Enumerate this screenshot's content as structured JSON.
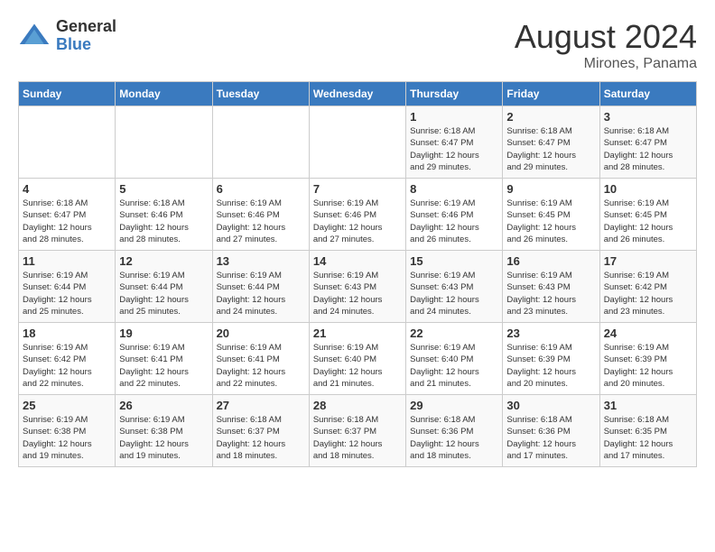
{
  "header": {
    "logo_general": "General",
    "logo_blue": "Blue",
    "month_year": "August 2024",
    "location": "Mirones, Panama"
  },
  "days_of_week": [
    "Sunday",
    "Monday",
    "Tuesday",
    "Wednesday",
    "Thursday",
    "Friday",
    "Saturday"
  ],
  "weeks": [
    [
      {
        "day": "",
        "info": ""
      },
      {
        "day": "",
        "info": ""
      },
      {
        "day": "",
        "info": ""
      },
      {
        "day": "",
        "info": ""
      },
      {
        "day": "1",
        "info": "Sunrise: 6:18 AM\nSunset: 6:47 PM\nDaylight: 12 hours\nand 29 minutes."
      },
      {
        "day": "2",
        "info": "Sunrise: 6:18 AM\nSunset: 6:47 PM\nDaylight: 12 hours\nand 29 minutes."
      },
      {
        "day": "3",
        "info": "Sunrise: 6:18 AM\nSunset: 6:47 PM\nDaylight: 12 hours\nand 28 minutes."
      }
    ],
    [
      {
        "day": "4",
        "info": "Sunrise: 6:18 AM\nSunset: 6:47 PM\nDaylight: 12 hours\nand 28 minutes."
      },
      {
        "day": "5",
        "info": "Sunrise: 6:18 AM\nSunset: 6:46 PM\nDaylight: 12 hours\nand 28 minutes."
      },
      {
        "day": "6",
        "info": "Sunrise: 6:19 AM\nSunset: 6:46 PM\nDaylight: 12 hours\nand 27 minutes."
      },
      {
        "day": "7",
        "info": "Sunrise: 6:19 AM\nSunset: 6:46 PM\nDaylight: 12 hours\nand 27 minutes."
      },
      {
        "day": "8",
        "info": "Sunrise: 6:19 AM\nSunset: 6:46 PM\nDaylight: 12 hours\nand 26 minutes."
      },
      {
        "day": "9",
        "info": "Sunrise: 6:19 AM\nSunset: 6:45 PM\nDaylight: 12 hours\nand 26 minutes."
      },
      {
        "day": "10",
        "info": "Sunrise: 6:19 AM\nSunset: 6:45 PM\nDaylight: 12 hours\nand 26 minutes."
      }
    ],
    [
      {
        "day": "11",
        "info": "Sunrise: 6:19 AM\nSunset: 6:44 PM\nDaylight: 12 hours\nand 25 minutes."
      },
      {
        "day": "12",
        "info": "Sunrise: 6:19 AM\nSunset: 6:44 PM\nDaylight: 12 hours\nand 25 minutes."
      },
      {
        "day": "13",
        "info": "Sunrise: 6:19 AM\nSunset: 6:44 PM\nDaylight: 12 hours\nand 24 minutes."
      },
      {
        "day": "14",
        "info": "Sunrise: 6:19 AM\nSunset: 6:43 PM\nDaylight: 12 hours\nand 24 minutes."
      },
      {
        "day": "15",
        "info": "Sunrise: 6:19 AM\nSunset: 6:43 PM\nDaylight: 12 hours\nand 24 minutes."
      },
      {
        "day": "16",
        "info": "Sunrise: 6:19 AM\nSunset: 6:43 PM\nDaylight: 12 hours\nand 23 minutes."
      },
      {
        "day": "17",
        "info": "Sunrise: 6:19 AM\nSunset: 6:42 PM\nDaylight: 12 hours\nand 23 minutes."
      }
    ],
    [
      {
        "day": "18",
        "info": "Sunrise: 6:19 AM\nSunset: 6:42 PM\nDaylight: 12 hours\nand 22 minutes."
      },
      {
        "day": "19",
        "info": "Sunrise: 6:19 AM\nSunset: 6:41 PM\nDaylight: 12 hours\nand 22 minutes."
      },
      {
        "day": "20",
        "info": "Sunrise: 6:19 AM\nSunset: 6:41 PM\nDaylight: 12 hours\nand 22 minutes."
      },
      {
        "day": "21",
        "info": "Sunrise: 6:19 AM\nSunset: 6:40 PM\nDaylight: 12 hours\nand 21 minutes."
      },
      {
        "day": "22",
        "info": "Sunrise: 6:19 AM\nSunset: 6:40 PM\nDaylight: 12 hours\nand 21 minutes."
      },
      {
        "day": "23",
        "info": "Sunrise: 6:19 AM\nSunset: 6:39 PM\nDaylight: 12 hours\nand 20 minutes."
      },
      {
        "day": "24",
        "info": "Sunrise: 6:19 AM\nSunset: 6:39 PM\nDaylight: 12 hours\nand 20 minutes."
      }
    ],
    [
      {
        "day": "25",
        "info": "Sunrise: 6:19 AM\nSunset: 6:38 PM\nDaylight: 12 hours\nand 19 minutes."
      },
      {
        "day": "26",
        "info": "Sunrise: 6:19 AM\nSunset: 6:38 PM\nDaylight: 12 hours\nand 19 minutes."
      },
      {
        "day": "27",
        "info": "Sunrise: 6:18 AM\nSunset: 6:37 PM\nDaylight: 12 hours\nand 18 minutes."
      },
      {
        "day": "28",
        "info": "Sunrise: 6:18 AM\nSunset: 6:37 PM\nDaylight: 12 hours\nand 18 minutes."
      },
      {
        "day": "29",
        "info": "Sunrise: 6:18 AM\nSunset: 6:36 PM\nDaylight: 12 hours\nand 18 minutes."
      },
      {
        "day": "30",
        "info": "Sunrise: 6:18 AM\nSunset: 6:36 PM\nDaylight: 12 hours\nand 17 minutes."
      },
      {
        "day": "31",
        "info": "Sunrise: 6:18 AM\nSunset: 6:35 PM\nDaylight: 12 hours\nand 17 minutes."
      }
    ]
  ]
}
